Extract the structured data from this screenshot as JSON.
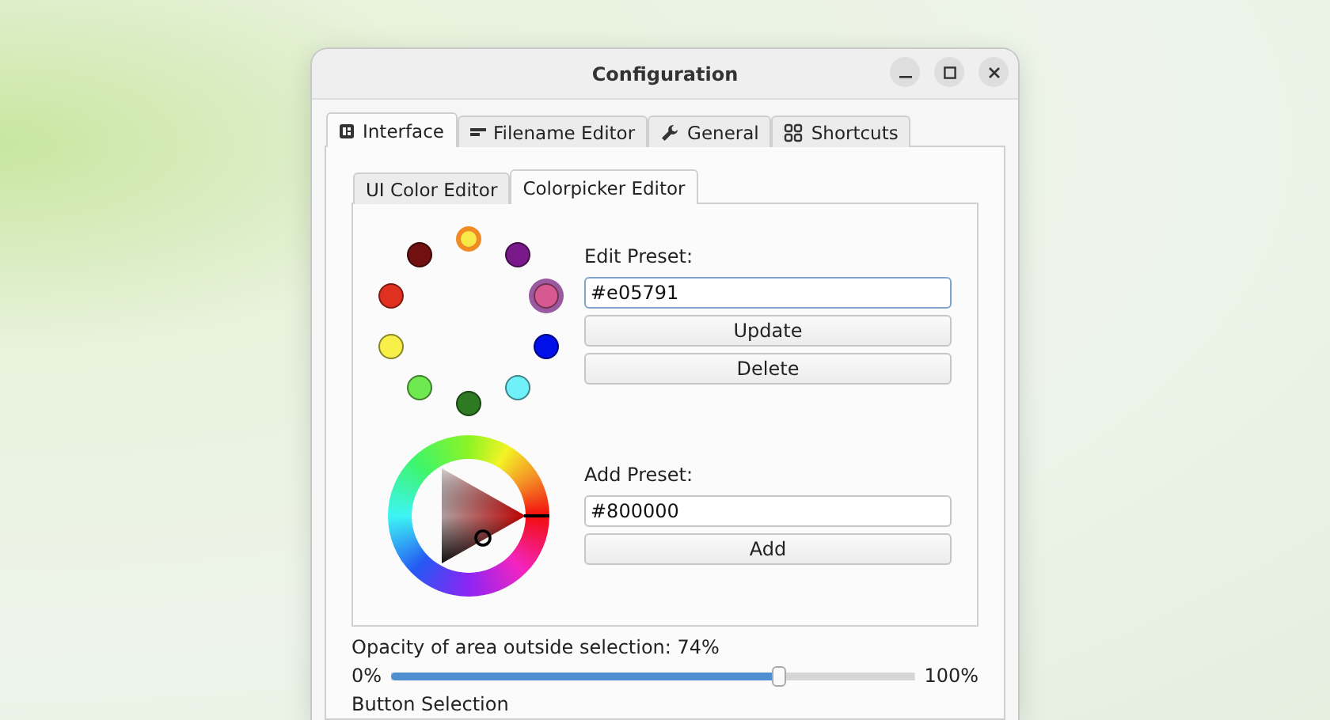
{
  "window": {
    "title": "Configuration"
  },
  "tabs": [
    {
      "label": "Interface",
      "kind": "panel",
      "selected": true
    },
    {
      "label": "Filename Editor",
      "kind": "lines",
      "selected": false
    },
    {
      "label": "General",
      "kind": "wrench",
      "selected": false
    },
    {
      "label": "Shortcuts",
      "kind": "grid",
      "selected": false
    }
  ],
  "subtabs": [
    {
      "label": "UI Color Editor",
      "selected": false
    },
    {
      "label": "Colorpicker Editor",
      "selected": true
    }
  ],
  "presets": [
    {
      "color": "#f7e948",
      "selected": false,
      "highlighted": true
    },
    {
      "color": "#7a1a8a",
      "selected": false,
      "highlighted": false
    },
    {
      "color": "#d65a91",
      "selected": true,
      "highlighted": false
    },
    {
      "color": "#0010e8",
      "selected": false,
      "highlighted": false
    },
    {
      "color": "#70f0f8",
      "selected": false,
      "highlighted": false
    },
    {
      "color": "#2e7a22",
      "selected": false,
      "highlighted": false
    },
    {
      "color": "#70e850",
      "selected": false,
      "highlighted": false
    },
    {
      "color": "#f8f048",
      "selected": false,
      "highlighted": false
    },
    {
      "color": "#e03020",
      "selected": false,
      "highlighted": false
    },
    {
      "color": "#701010",
      "selected": false,
      "highlighted": false
    }
  ],
  "edit_preset": {
    "label": "Edit Preset:",
    "value": "#e05791",
    "buttons": [
      "Update",
      "Delete"
    ]
  },
  "add_preset": {
    "label": "Add Preset:",
    "value": "#800000",
    "button": "Add"
  },
  "opacity": {
    "label": "Opacity of area outside selection: 74%",
    "min_label": "0%",
    "max_label": "100%",
    "level": 0.74
  },
  "button_selection": {
    "title": "Button Selection"
  }
}
